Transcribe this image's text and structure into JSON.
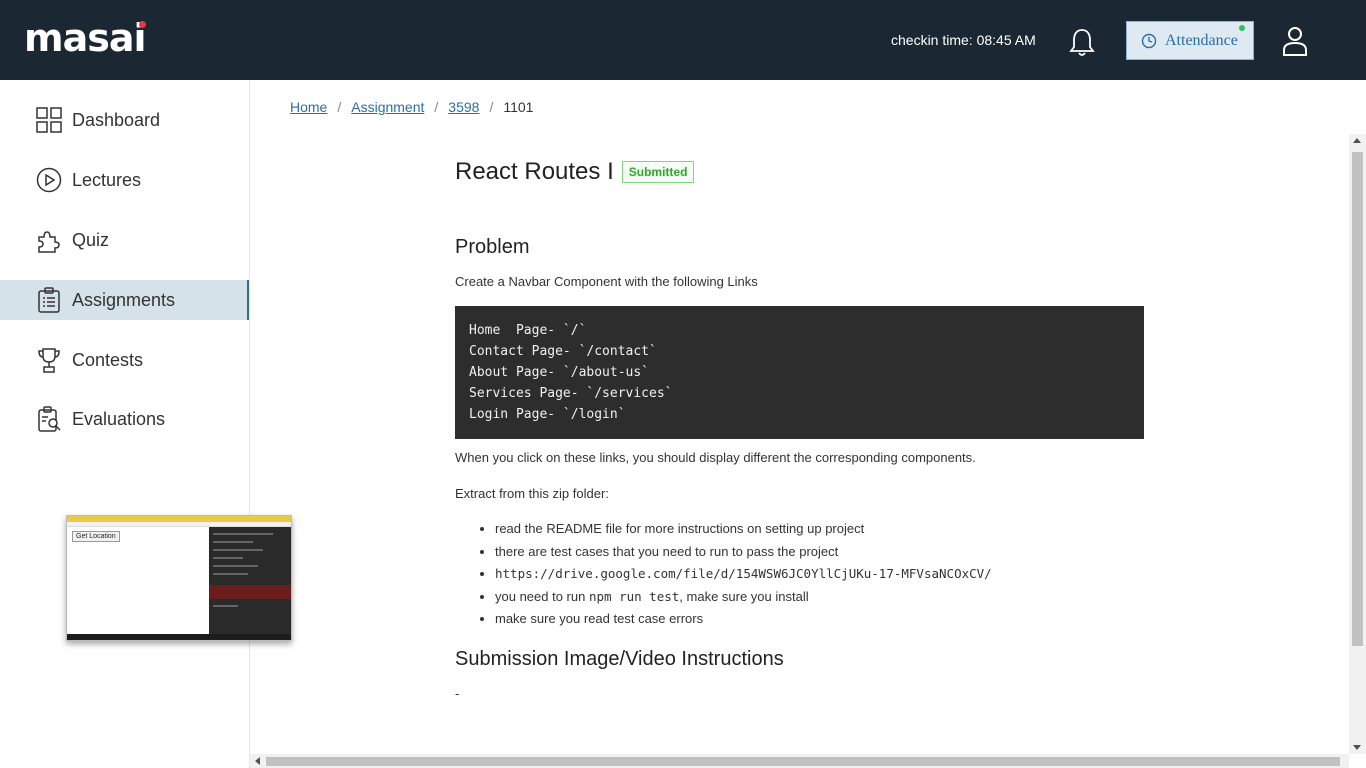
{
  "header": {
    "logo": "masai",
    "checkin": "checkin time: 08:45 AM",
    "attendance_label": "Attendance"
  },
  "sidebar": {
    "items": [
      {
        "label": "Dashboard",
        "icon": "grid-icon",
        "active": false
      },
      {
        "label": "Lectures",
        "icon": "play-circle-icon",
        "active": false
      },
      {
        "label": "Quiz",
        "icon": "puzzle-icon",
        "active": false
      },
      {
        "label": "Assignments",
        "icon": "clipboard-icon",
        "active": true
      },
      {
        "label": "Contests",
        "icon": "trophy-icon",
        "active": false
      },
      {
        "label": "Evaluations",
        "icon": "evaluation-icon",
        "active": false
      }
    ],
    "preview_button": "Get Location"
  },
  "breadcrumb": {
    "home": "Home",
    "assignment": "Assignment",
    "id": "3598",
    "current": "1101"
  },
  "assignment": {
    "title": "React Routes I",
    "status": "Submitted",
    "problem_heading": "Problem",
    "intro": "Create a Navbar Component with the following Links",
    "code_lines": [
      "Home  Page- `/`",
      "Contact Page- `/contact`",
      "About Page- `/about-us`",
      "Services Page- `/services`",
      "Login Page- `/login`"
    ],
    "click_text": "When you click on these links, you should display different the corresponding components.",
    "extract_text": "Extract from this zip folder:",
    "bullets": {
      "b1": "read the README file for more instructions on setting up project",
      "b2": "there are test cases that you need to run to pass the project",
      "b3": "https://drive.google.com/file/d/154WSW6JC0YllCjUKu-17-MFVsaNCOxCV/",
      "b4_pre": "you need to run ",
      "b4_code": "npm run test",
      "b4_post": ", make sure you install",
      "b5": "make sure you read test case errors"
    },
    "submission_heading": "Submission Image/Video Instructions",
    "submission_text": "-"
  },
  "colors": {
    "topbar": "#1b2733",
    "accent": "#2a6ea8",
    "active_nav": "#d6e2e9",
    "submitted": "#2fa52f",
    "code_bg": "#2d2d2d"
  }
}
